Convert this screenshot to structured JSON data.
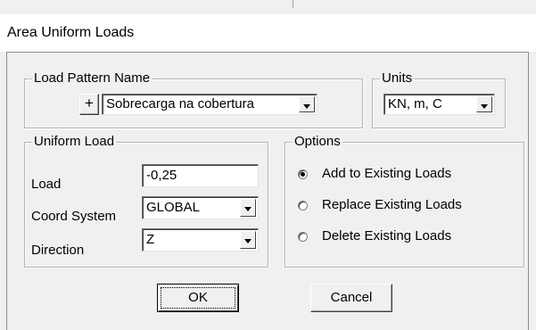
{
  "window": {
    "title": "Area Uniform Loads"
  },
  "load_pattern": {
    "legend": "Load Pattern Name",
    "add_label": "+",
    "selected": "Sobrecarga na cobertura"
  },
  "units": {
    "legend": "Units",
    "selected": "KN, m, C"
  },
  "uniform_load": {
    "legend": "Uniform Load",
    "load_label": "Load",
    "load_value": "-0,25",
    "coord_label": "Coord System",
    "coord_value": "GLOBAL",
    "direction_label": "Direction",
    "direction_value": "Z"
  },
  "options": {
    "legend": "Options",
    "items": [
      {
        "label": "Add to Existing Loads",
        "selected": true
      },
      {
        "label": "Replace Existing Loads",
        "selected": false
      },
      {
        "label": "Delete Existing Loads",
        "selected": false
      }
    ]
  },
  "buttons": {
    "ok": "OK",
    "cancel": "Cancel"
  }
}
